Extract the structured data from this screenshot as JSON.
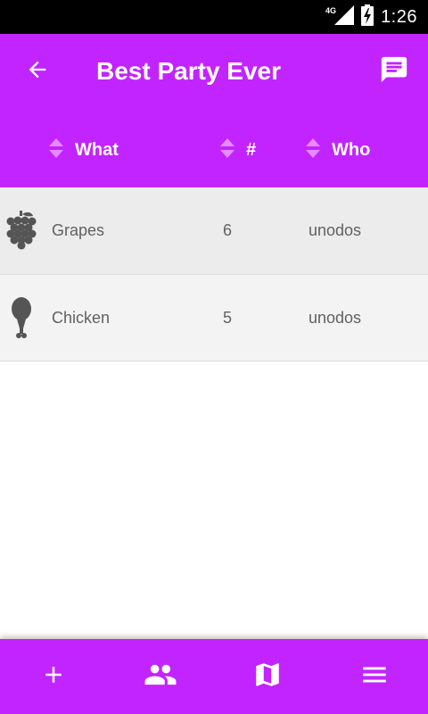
{
  "status_bar": {
    "network": "4G",
    "time": "1:26"
  },
  "app_bar": {
    "title": "Best Party Ever",
    "back_icon": "arrow-back-icon",
    "chat_icon": "chat-icon"
  },
  "table": {
    "columns": [
      {
        "label": "What",
        "sort_icon": "sort-icon"
      },
      {
        "label": "#",
        "sort_icon": "sort-icon"
      },
      {
        "label": "Who",
        "sort_icon": "sort-icon"
      }
    ],
    "rows": [
      {
        "icon": "grapes-icon",
        "what": "Grapes",
        "qty": "6",
        "who": "unodos"
      },
      {
        "icon": "chicken-leg-icon",
        "what": "Chicken",
        "qty": "5",
        "who": "unodos"
      }
    ]
  },
  "bottom_nav": [
    {
      "icon": "add-icon"
    },
    {
      "icon": "people-icon"
    },
    {
      "icon": "map-icon"
    },
    {
      "icon": "menu-icon"
    }
  ],
  "colors": {
    "accent": "#c224ff",
    "row_alt_1": "#ececec",
    "row_alt_2": "#f3f3f3",
    "text_secondary": "#616161"
  }
}
